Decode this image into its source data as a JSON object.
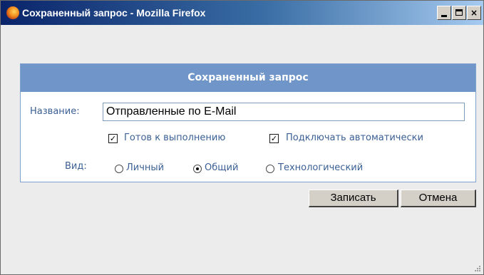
{
  "window": {
    "title": "Сохраненный запрос - Mozilla Firefox",
    "icon": "firefox-icon",
    "controls": {
      "minimize": "minimize-icon",
      "maximize": "maximize-icon",
      "close_label": "×"
    }
  },
  "panel": {
    "header": "Сохраненный запрос",
    "name_label": "Название:",
    "name_value": "Отправленные по E-Mail",
    "checkboxes": [
      {
        "label": "Готов к выполнению",
        "checked": true
      },
      {
        "label": "Подключать автоматически",
        "checked": true
      }
    ],
    "check_mark": "✓",
    "view_label": "Вид:",
    "view_options": [
      {
        "label": "Личный",
        "selected": false
      },
      {
        "label": "Общий",
        "selected": true
      },
      {
        "label": "Технологический",
        "selected": false
      }
    ]
  },
  "buttons": {
    "save": "Записать",
    "cancel": "Отмена"
  },
  "colors": {
    "header_bg": "#7095c8",
    "label_text": "#3a5f94",
    "titlebar_start": "#0a246a"
  }
}
